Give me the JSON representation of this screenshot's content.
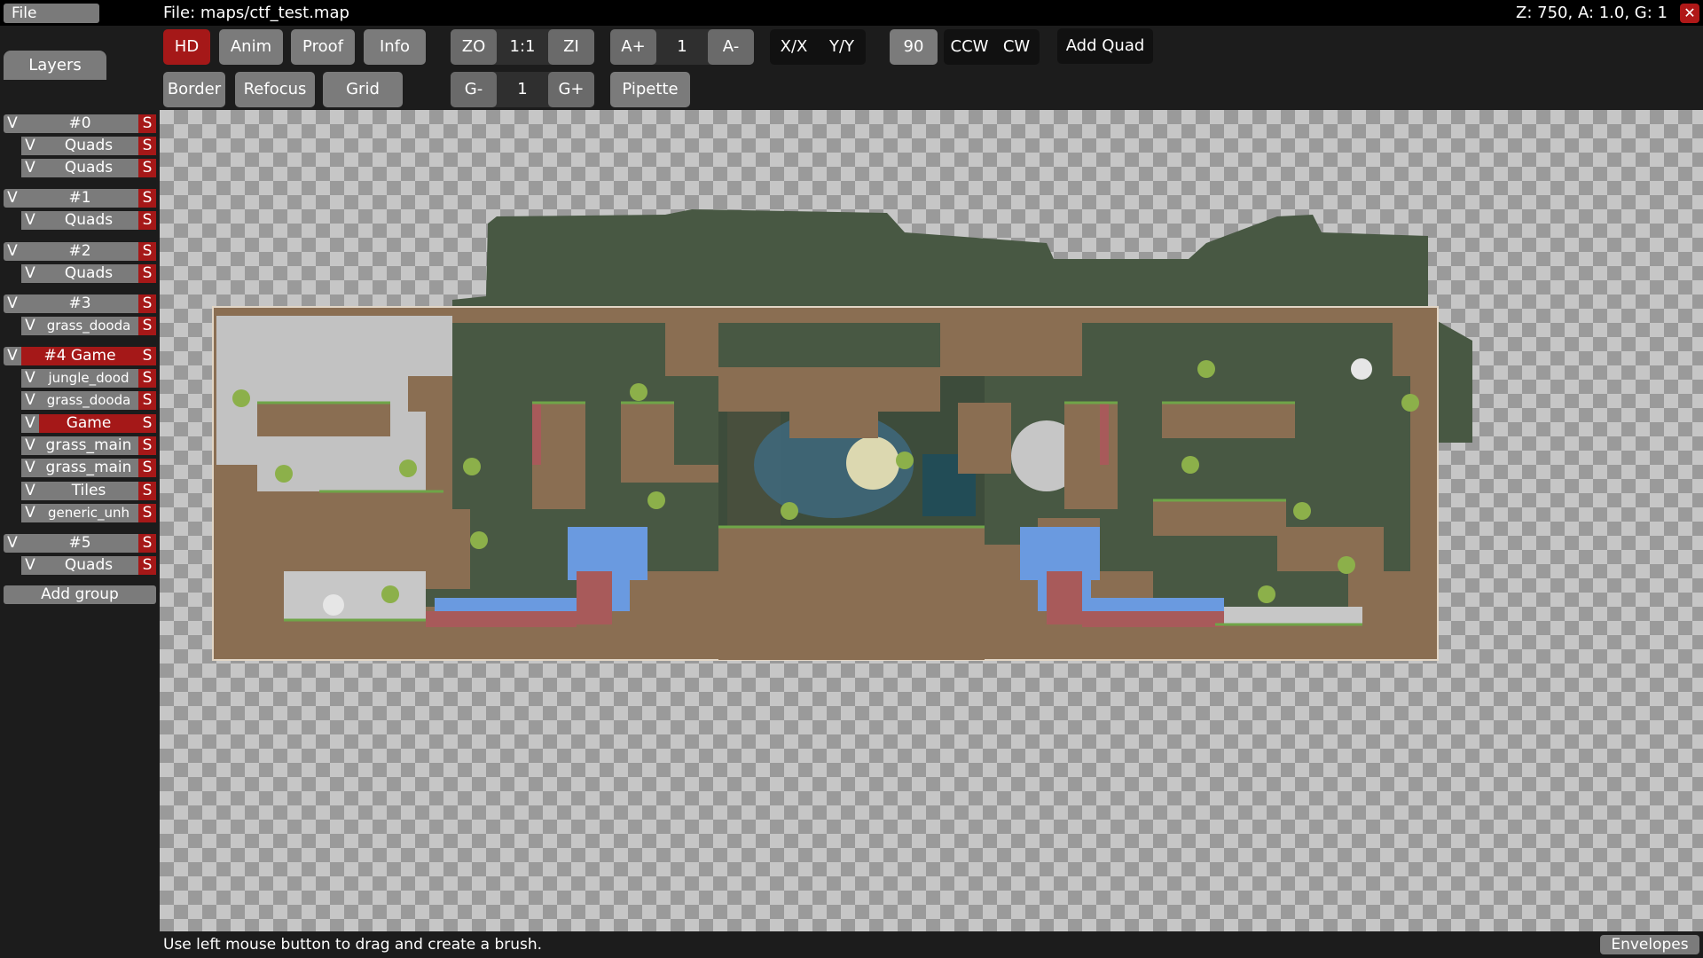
{
  "menubar": {
    "file_label": "File",
    "file_path": "File: maps/ctf_test.map",
    "status": "Z: 750, A: 1.0, G: 1",
    "close_glyph": "✕"
  },
  "toolbar": {
    "hd": "HD",
    "anim": "Anim",
    "proof": "Proof",
    "info": "Info",
    "zo": "ZO",
    "zoom_reset": "1:1",
    "zi": "ZI",
    "a_plus": "A+",
    "a_value": "1",
    "a_minus": "A-",
    "flip_x": "X/X",
    "flip_y": "Y/Y",
    "rot_value": "90",
    "ccw": "CCW",
    "cw": "CW",
    "add_quad": "Add Quad",
    "border": "Border",
    "refocus": "Refocus",
    "grid": "Grid",
    "g_minus": "G-",
    "g_value": "1",
    "g_plus": "G+",
    "pipette": "Pipette"
  },
  "sidebar": {
    "tab_label": "Layers",
    "v": "V",
    "s": "S",
    "groups": [
      {
        "label": "#0",
        "layers": [
          "Quads",
          "Quads"
        ]
      },
      {
        "label": "#1",
        "layers": [
          "Quads"
        ]
      },
      {
        "label": "#2",
        "layers": [
          "Quads"
        ]
      },
      {
        "label": "#3",
        "layers": [
          "grass_dooda"
        ]
      },
      {
        "label": "#4 Game",
        "layers": [
          "jungle_dood",
          "grass_dooda",
          "Game",
          "grass_main",
          "grass_main",
          "Tiles",
          "generic_unh"
        ]
      },
      {
        "label": "#5",
        "layers": [
          "Quads"
        ]
      }
    ],
    "add_group": "Add group"
  },
  "bottombar": {
    "hint": "Use left mouse button to drag and create a brush.",
    "envelopes": "Envelopes"
  },
  "colors": {
    "accent_red": "#a51818",
    "button_grey": "#7b7b7b",
    "panel_dark": "#1c1c1c",
    "dirt": "#8a6e52",
    "jungle": "#485843",
    "water": "#6a9ae0"
  }
}
